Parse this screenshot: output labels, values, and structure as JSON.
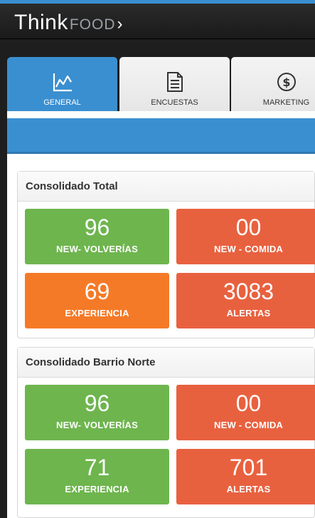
{
  "brand": {
    "think": "Think",
    "food": "FOOD",
    "chevron": "›"
  },
  "tabs": [
    {
      "label": "GENERAL",
      "icon": "line-chart-icon",
      "active": true
    },
    {
      "label": "ENCUESTAS",
      "icon": "document-icon",
      "active": false
    },
    {
      "label": "MARKETING",
      "icon": "dollar-icon",
      "active": false
    }
  ],
  "colors": {
    "accent": "#3a8fd0",
    "green": "#6eb54e",
    "red": "#e8613f",
    "orange": "#f57a27"
  },
  "cards": [
    {
      "title": "Consolidado Total",
      "tiles": [
        {
          "value": "96",
          "label": "NEW- VOLVERÍAS",
          "color": "green"
        },
        {
          "value": "00",
          "label": "NEW - COMIDA",
          "color": "red"
        },
        {
          "value": "69",
          "label": "EXPERIENCIA",
          "color": "orange"
        },
        {
          "value": "3083",
          "label": "ALERTAS",
          "color": "red"
        }
      ]
    },
    {
      "title": "Consolidado Barrio Norte",
      "tiles": [
        {
          "value": "96",
          "label": "NEW- VOLVERÍAS",
          "color": "green"
        },
        {
          "value": "00",
          "label": "NEW - COMIDA",
          "color": "red"
        },
        {
          "value": "71",
          "label": "EXPERIENCIA",
          "color": "green"
        },
        {
          "value": "701",
          "label": "ALERTAS",
          "color": "red"
        }
      ]
    }
  ]
}
